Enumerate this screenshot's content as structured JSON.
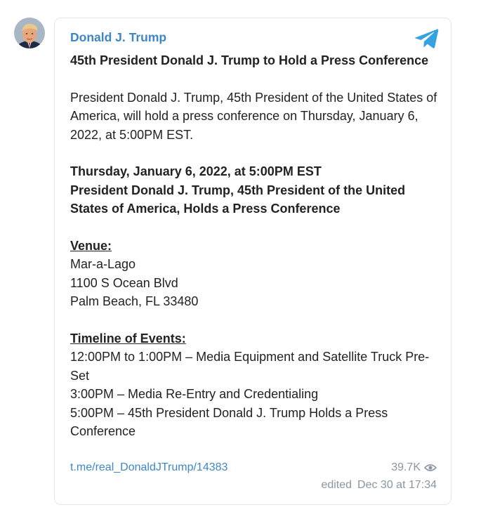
{
  "post": {
    "author": "Donald J. Trump",
    "avatar_icon": "profile-photo",
    "platform_icon": "telegram-icon",
    "accent_color": "#3c87c8",
    "title": "45th President Donald J. Trump to Hold a Press Conference",
    "intro": "President Donald J. Trump, 45th President of the United States of America, will hold a press conference on Thursday, January 6, 2022, at 5:00PM EST.",
    "date_line": "Thursday, January 6, 2022, at 5:00PM EST",
    "headline": "President Donald J. Trump, 45th President of the United States of America, Holds a Press Conference",
    "venue": {
      "label": "Venue:",
      "lines": [
        "Mar-a-Lago",
        "1100 S Ocean Blvd",
        "Palm Beach, FL 33480"
      ]
    },
    "timeline": {
      "label": "Timeline of Events:",
      "items": [
        "12:00PM to 1:00PM – Media Equipment and Satellite Truck Pre-Set",
        "3:00PM – Media Re-Entry and Credentialing",
        "5:00PM – 45th President Donald J. Trump Holds a Press Conference"
      ]
    },
    "link": "t.me/real_DonaldJTrump/14383",
    "views": "39.7K",
    "views_icon": "eye-icon",
    "edited_label": "edited",
    "edited_date": "Dec 30 at 17:34"
  }
}
